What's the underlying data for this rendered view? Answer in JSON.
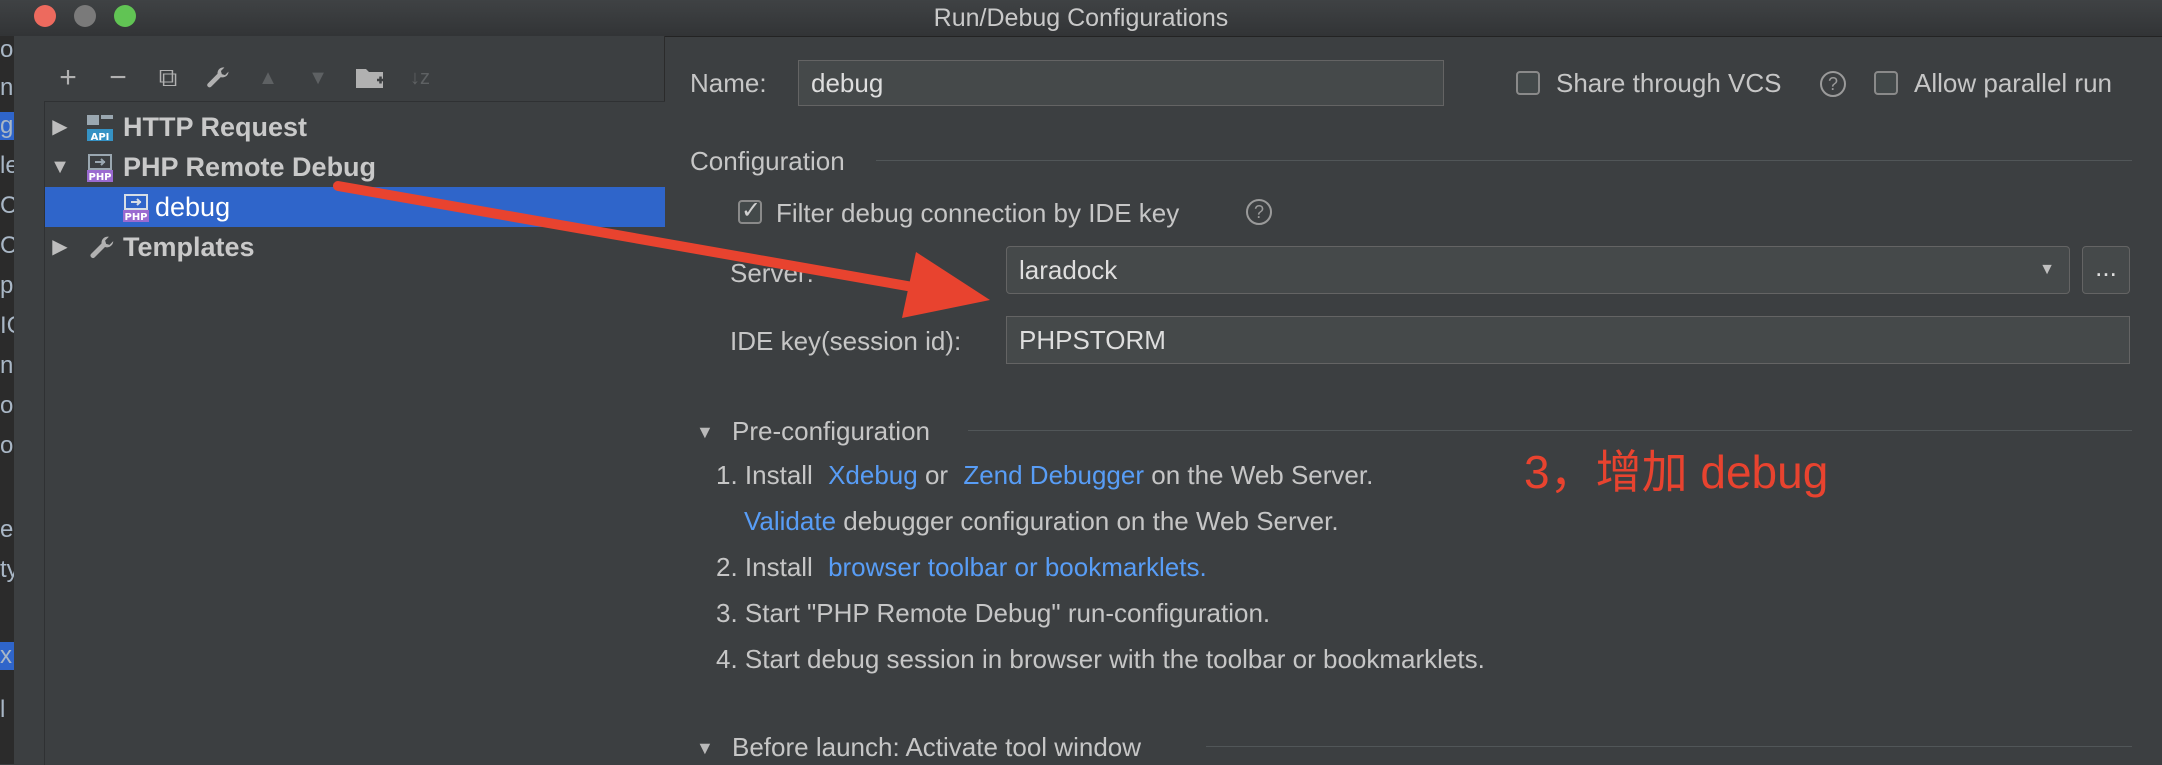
{
  "window": {
    "title": "Run/Debug Configurations"
  },
  "ide_strip": [
    "on",
    "nc",
    "g.",
    "le",
    "C",
    "C",
    "ph",
    "IC",
    "n",
    "or",
    "o",
    "ers",
    "ty",
    "x.",
    "l"
  ],
  "toolbar": {
    "add": "+",
    "remove": "−",
    "copy": "⧉",
    "edit": "🔧",
    "up": "▲",
    "down": "▼",
    "folder": "📁",
    "sort": "↓z"
  },
  "tree": {
    "items": [
      {
        "label": "HTTP Request",
        "icon": "api-icon",
        "expanded": false
      },
      {
        "label": "PHP Remote Debug",
        "icon": "php-icon",
        "expanded": true
      },
      {
        "label": "debug",
        "icon": "php-icon",
        "selected": true
      },
      {
        "label": "Templates",
        "icon": "wrench-icon",
        "expanded": false
      }
    ]
  },
  "form": {
    "name_label": "Name:",
    "name_value": "debug",
    "share_vcs_label": "Share through VCS",
    "share_vcs_checked": false,
    "allow_parallel_label": "Allow parallel run",
    "allow_parallel_checked": false,
    "configuration_header": "Configuration",
    "filter_label": "Filter debug connection by IDE key",
    "filter_checked": true,
    "server_label": "Server:",
    "server_value": "laradock",
    "browse_button": "...",
    "ide_key_label": "IDE key(session id):",
    "ide_key_value": "PHPSTORM"
  },
  "preconfig": {
    "header": "Pre-configuration",
    "step1_prefix": "1. Install",
    "xdebug": "Xdebug",
    "or": "or",
    "zend": "Zend Debugger",
    "step1_suffix": "on the Web Server.",
    "validate": "Validate",
    "validate_suffix": "debugger configuration on the Web Server.",
    "step2_prefix": "2. Install",
    "step2_link": "browser toolbar or bookmarklets.",
    "step3": "3. Start \"PHP Remote Debug\" run-configuration.",
    "step4": "4. Start debug session in browser with the toolbar or bookmarklets."
  },
  "before_launch": {
    "header": "Before launch: Activate tool window"
  },
  "annotation": {
    "text": "3，增加 debug",
    "color": "#e8432f"
  },
  "colors": {
    "selection": "#2f65ca",
    "link": "#589df6",
    "annotation": "#e8432f"
  }
}
